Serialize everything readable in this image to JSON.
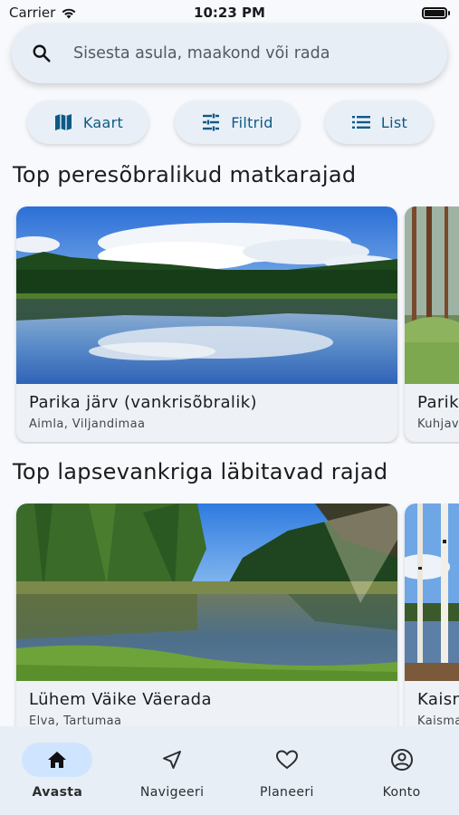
{
  "status_bar": {
    "carrier": "Carrier",
    "time": "10:23 PM"
  },
  "search": {
    "placeholder": "Sisesta asula, maakond või rada"
  },
  "actions": [
    {
      "label": "Kaart",
      "icon": "map-icon"
    },
    {
      "label": "Filtrid",
      "icon": "tune-icon"
    },
    {
      "label": "List",
      "icon": "list-icon"
    }
  ],
  "sections": [
    {
      "title": "Top peresõbralikud matkarajad",
      "cards": [
        {
          "title": "Parika järv (vankrisõbralik)",
          "subtitle": "Aimla, Viljandimaa"
        },
        {
          "title": "Parik",
          "subtitle": "Kuhjav"
        }
      ]
    },
    {
      "title": "Top lapsevankriga läbitavad rajad",
      "cards": [
        {
          "title": "Lühem Väike Väerada",
          "subtitle": "Elva, Tartumaa"
        },
        {
          "title": "Kaisn",
          "subtitle": "Kaisma"
        }
      ]
    }
  ],
  "bottom_nav": [
    {
      "label": "Avasta",
      "icon": "home-icon",
      "active": true
    },
    {
      "label": "Navigeeri",
      "icon": "navigation-icon",
      "active": false
    },
    {
      "label": "Planeeri",
      "icon": "heart-icon",
      "active": false
    },
    {
      "label": "Konto",
      "icon": "account-icon",
      "active": false
    }
  ],
  "colors": {
    "accent": "#0d5a87",
    "nav_active": "#cfe5ff",
    "background": "#f7f9fc"
  }
}
